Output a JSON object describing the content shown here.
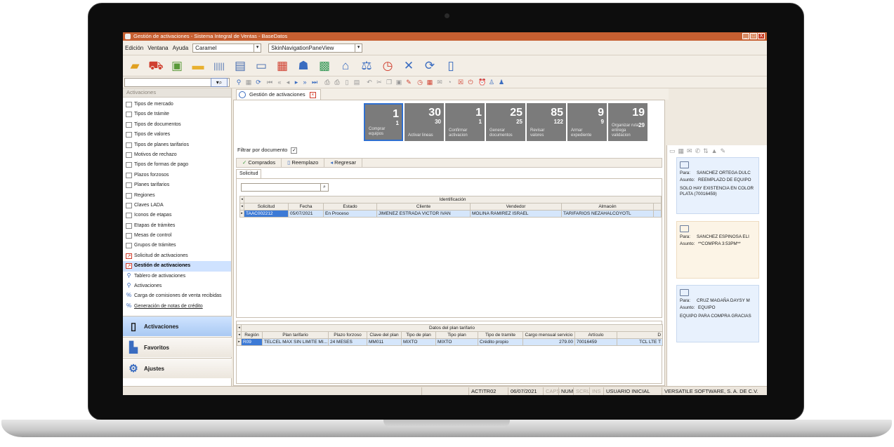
{
  "window": {
    "title": "Gestión de activaciones - Sistema Integral de Ventas - BaseDatos",
    "buttons": [
      "_",
      "□",
      "X"
    ]
  },
  "menu": {
    "items": [
      "Edición",
      "Ventana",
      "Ayuda"
    ],
    "skin_value": "Caramel",
    "view_value": "SkinNavigationPaneView"
  },
  "toolbar": {
    "big_icons": [
      "folder-icon",
      "cart-icon",
      "card-check-icon",
      "folder-open-icon",
      "barcode-icon",
      "document-icon",
      "id-card-icon",
      "document-stack-icon",
      "users-icon",
      "money-icon",
      "bank-icon",
      "scale-icon",
      "clock-icon",
      "tools-icon",
      "sync-icon",
      "phone-icon"
    ],
    "small_icons": [
      "binoculars-icon",
      "grid-icon",
      "refresh-icon",
      "first-icon",
      "prev-page-icon",
      "prev-icon",
      "next-icon",
      "next-page-icon",
      "last-icon",
      "print-icon",
      "print-preview-icon",
      "page-icon",
      "export-icon",
      "undo-icon",
      "cut-icon",
      "copy-icon",
      "paste-icon",
      "eraser-icon",
      "clock-icon",
      "calendar-icon",
      "mail-icon",
      "history-icon",
      "cancel-icon",
      "power-icon",
      "alarm-icon",
      "user-icon",
      "users-icon"
    ]
  },
  "sidebar": {
    "header": "Activaciones",
    "items": [
      {
        "label": "Tipos de mercado",
        "icon": "table-icon"
      },
      {
        "label": "Tipos de trámite",
        "icon": "table-icon"
      },
      {
        "label": "Tipos de documentos",
        "icon": "table-icon"
      },
      {
        "label": "Tipos de valores",
        "icon": "table-icon"
      },
      {
        "label": "Tipos de planes tarifarios",
        "icon": "table-icon"
      },
      {
        "label": "Motivos de rechazo",
        "icon": "table-icon"
      },
      {
        "label": "Tipos de formas de pago",
        "icon": "table-icon"
      },
      {
        "label": "Plazos forzosos",
        "icon": "table-icon"
      },
      {
        "label": "Planes tarifarios",
        "icon": "table-icon"
      },
      {
        "label": "Regiones",
        "icon": "table-icon"
      },
      {
        "label": "Claves LADA",
        "icon": "table-icon"
      },
      {
        "label": "Iconos de etapas",
        "icon": "table-icon"
      },
      {
        "label": "Etapas de trámites",
        "icon": "table-icon"
      },
      {
        "label": "Mesas de control",
        "icon": "table-icon"
      },
      {
        "label": "Grupos de trámites",
        "icon": "table-icon"
      },
      {
        "label": "Solicitud de activaciones",
        "icon": "form-icon"
      },
      {
        "label": "Gestión de activaciones",
        "icon": "form-icon"
      },
      {
        "label": "Tablero de activaciones",
        "icon": "search-icon"
      },
      {
        "label": "Activaciones",
        "icon": "search-icon"
      },
      {
        "label": "Carga de comisiones de venta recibidas",
        "icon": "percent-icon"
      },
      {
        "label": "Generación de notas de crédito",
        "icon": "percent-icon"
      }
    ],
    "nav_buttons": [
      "Activaciones",
      "Favoritos",
      "Ajustes"
    ]
  },
  "tab": {
    "label": "Gestión de activaciones"
  },
  "tiles": [
    {
      "big": "1",
      "small": "1",
      "label": "Comprar equipos"
    },
    {
      "big": "30",
      "small": "30",
      "label": "Activar lineas"
    },
    {
      "big": "1",
      "small": "1",
      "label": "Confirmar activacion"
    },
    {
      "big": "25",
      "small": "25",
      "label": "Generar documentos"
    },
    {
      "big": "85",
      "small": "122",
      "label": "Revisar valores"
    },
    {
      "big": "9",
      "small": "9",
      "label": "Armar expediente"
    },
    {
      "big": "19",
      "small": "29",
      "label": "Organizar ruta entrega validacion"
    }
  ],
  "filter": {
    "label": "Filtrar por documento",
    "check": "✓"
  },
  "actions": [
    {
      "icon": "check-icon",
      "label": "Comprados"
    },
    {
      "icon": "document-icon",
      "label": "Reemplazo"
    },
    {
      "icon": "back-icon",
      "label": "Regresar"
    }
  ],
  "subtab": "Solicitud",
  "grid1": {
    "band": "Identificación",
    "columns": [
      "Solicitud",
      "Fecha",
      "Estado",
      "Cliente",
      "Vendedor",
      "Almacén"
    ],
    "rows": [
      [
        "TAAC002212",
        "05/07/2021",
        "En Proceso",
        "JIMENEZ ESTRADA VICTOR IVAN",
        "MOLINA RAMIREZ ISRAEL",
        "TARIFARIOS NEZAHALCOYOTL"
      ]
    ]
  },
  "grid2": {
    "band": "Datos del plan tarifario",
    "columns": [
      "Región",
      "Plan tarifario",
      "Plazo forzoso",
      "Clave del plan",
      "Tipo de plan",
      "Tipo plan",
      "Tipo de tramite",
      "Cargo mensual servicio",
      "Artículo",
      "D"
    ],
    "rows": [
      [
        "R09",
        "TELCEL MAX SIN LIMITE MI...",
        "24 MESES",
        "MM011",
        "MIXTO",
        "MIXTO",
        "Crédito propio",
        "279.00",
        "70016459",
        "TCL LTE T"
      ]
    ]
  },
  "notes_panel": {
    "toolbar_icons": [
      "note-icon",
      "calendar-icon",
      "mail-icon",
      "phone-icon",
      "sort-icon",
      "warning-icon",
      "clip-icon"
    ],
    "notes": [
      {
        "para_label": "Para:",
        "para": "SANCHEZ ORTEGA DULC",
        "asunto_label": "Asunto:",
        "asunto": "REEMPLAZO DE EQUIPO",
        "body": "SOLO HAY EXISTENCIA EN COLOR PLATA (70016459)"
      },
      {
        "para_label": "Para:",
        "para": "SANCHEZ ESPINOSA ELI",
        "asunto_label": "Asunto:",
        "asunto": "**COMPRA 3:53PM**",
        "body": ""
      },
      {
        "para_label": "Para:",
        "para": "CRUZ MAGAÑA DAYSY M",
        "asunto_label": "Asunto:",
        "asunto": "EQUIPO",
        "body": "EQUIPO PARA COMPRA GRACIAS"
      }
    ]
  },
  "status": {
    "user_code": "ACTITR02",
    "date": "06/07/2021",
    "caps": "CAPS",
    "num": "NUM",
    "scrl": "SCRL",
    "ins": "INS",
    "user": "USUARIO INICIAL",
    "company": "VERSATILE SOFTWARE, S. A. DE C.V."
  }
}
